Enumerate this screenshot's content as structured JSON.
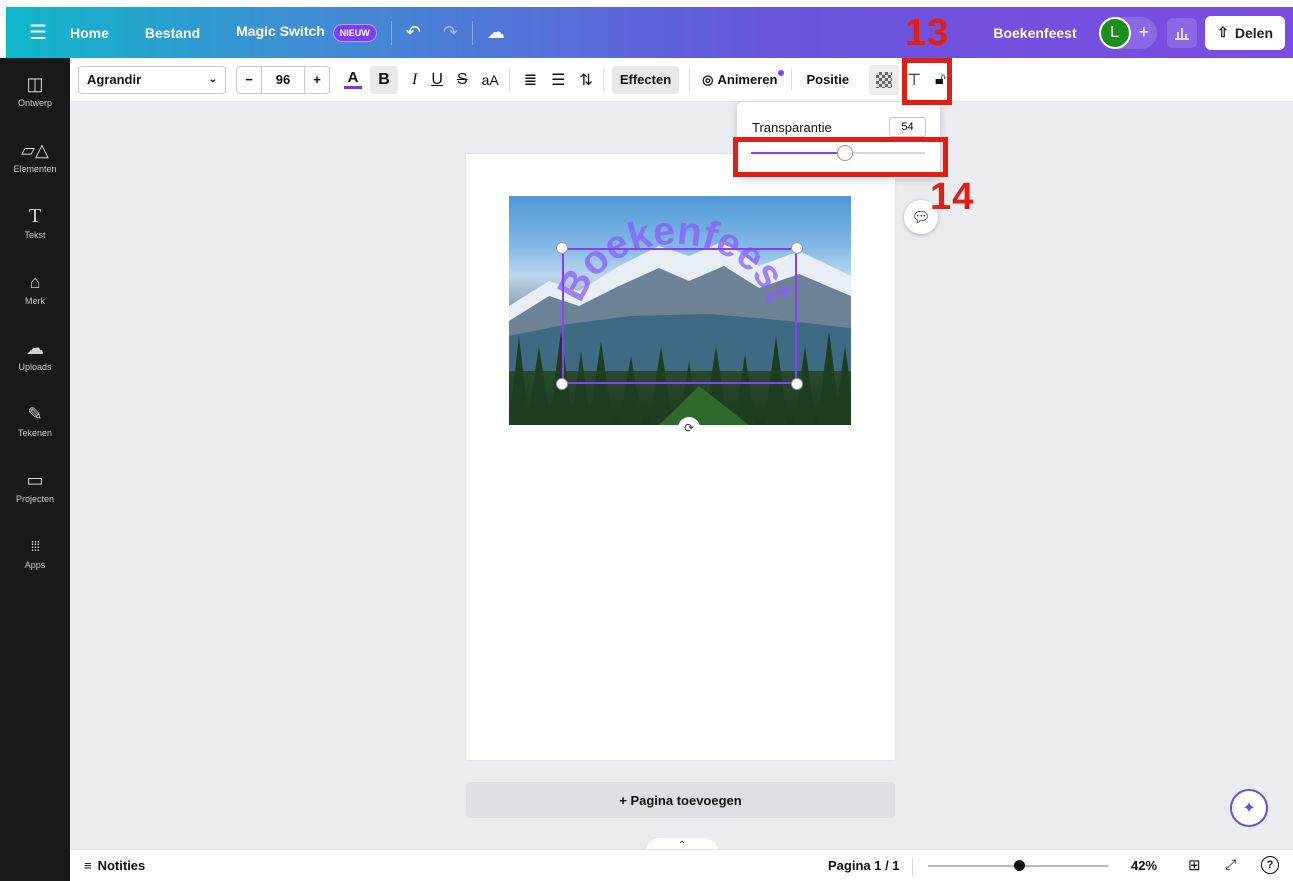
{
  "topbar": {
    "home": "Home",
    "file": "Bestand",
    "magic_switch": "Magic Switch",
    "magic_badge": "NIEUW",
    "project_name": "Boekenfeest",
    "avatar_initial": "L",
    "share": "Delen"
  },
  "sidebar": {
    "items": [
      {
        "label": "Ontwerp",
        "icon": "layout-icon"
      },
      {
        "label": "Elementen",
        "icon": "shapes-icon"
      },
      {
        "label": "Tekst",
        "icon": "text-icon"
      },
      {
        "label": "Merk",
        "icon": "brand-icon"
      },
      {
        "label": "Uploads",
        "icon": "cloud-upload-icon"
      },
      {
        "label": "Tekenen",
        "icon": "draw-icon"
      },
      {
        "label": "Projecten",
        "icon": "folder-icon"
      },
      {
        "label": "Apps",
        "icon": "apps-grid-icon"
      }
    ]
  },
  "toolbar": {
    "font": "Agrandir",
    "font_size": "96",
    "effects": "Effecten",
    "animate": "Animeren",
    "position": "Positie"
  },
  "transparency": {
    "label": "Transparantie",
    "value": "54",
    "level": 0.54
  },
  "canvas": {
    "curved_text": "Boekenfeest",
    "add_page": "+ Pagina toevoegen"
  },
  "annotations": {
    "step_13": "13",
    "step_14": "14",
    "color": "#e41d12"
  },
  "bottombar": {
    "notes": "Notities",
    "page_info": "Pagina 1 / 1",
    "zoom": "42%",
    "zoom_level": 0.42
  },
  "colors": {
    "accent": "#8b3dff",
    "sidebar_bg": "#18191b",
    "avatar_bg": "#1b8f1b"
  }
}
